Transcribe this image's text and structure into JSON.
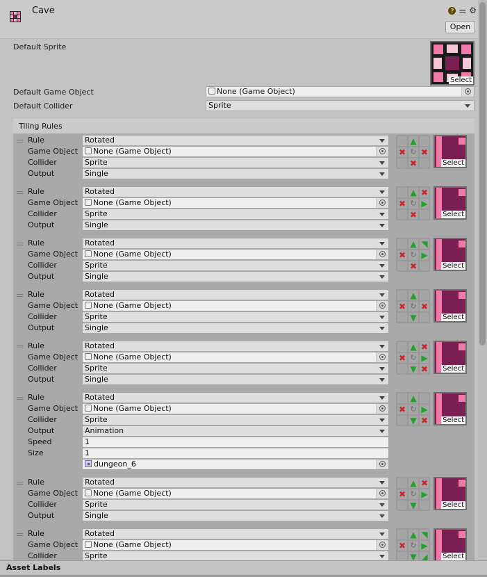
{
  "header": {
    "title": "Cave",
    "open_label": "Open",
    "icons": [
      "help-icon",
      "preset-icon",
      "gear-icon"
    ]
  },
  "defaults": {
    "sprite_label": "Default Sprite",
    "sprite_select": "Select",
    "game_object_label": "Default Game Object",
    "game_object_value": "None (Game Object)",
    "collider_label": "Default Collider",
    "collider_value": "Sprite"
  },
  "tiling_rules": {
    "title": "Tiling Rules",
    "field_labels": {
      "rule": "Rule",
      "game_object": "Game Object",
      "collider": "Collider",
      "output": "Output",
      "speed": "Speed",
      "size": "Size"
    },
    "select_label": "Select",
    "rules": [
      {
        "rule": "Rotated",
        "game_object": "None (Game Object)",
        "collider": "Sprite",
        "output": "Single",
        "grid": [
          "",
          "up",
          "",
          "x",
          "rotate",
          "x",
          "",
          "x",
          ""
        ]
      },
      {
        "rule": "Rotated",
        "game_object": "None (Game Object)",
        "collider": "Sprite",
        "output": "Single",
        "grid": [
          "",
          "up",
          "x",
          "x",
          "rotate",
          "right",
          "",
          "x",
          ""
        ]
      },
      {
        "rule": "Rotated",
        "game_object": "None (Game Object)",
        "collider": "Sprite",
        "output": "Single",
        "grid": [
          "",
          "up",
          "up-right",
          "x",
          "rotate",
          "right",
          "",
          "x",
          ""
        ]
      },
      {
        "rule": "Rotated",
        "game_object": "None (Game Object)",
        "collider": "Sprite",
        "output": "Single",
        "grid": [
          "",
          "up",
          "",
          "x",
          "rotate",
          "x",
          "",
          "down",
          ""
        ]
      },
      {
        "rule": "Rotated",
        "game_object": "None (Game Object)",
        "collider": "Sprite",
        "output": "Single",
        "grid": [
          "",
          "up",
          "x",
          "x",
          "rotate",
          "right",
          "",
          "down",
          "x"
        ]
      },
      {
        "rule": "Rotated",
        "game_object": "None (Game Object)",
        "collider": "Sprite",
        "output": "Animation",
        "speed": "1",
        "size": "1",
        "sprites": [
          "dungeon_6"
        ],
        "grid": [
          "",
          "up",
          "",
          "x",
          "rotate",
          "right",
          "",
          "down",
          "x"
        ]
      },
      {
        "rule": "Rotated",
        "game_object": "None (Game Object)",
        "collider": "Sprite",
        "output": "Single",
        "grid": [
          "",
          "up",
          "x",
          "x",
          "rotate",
          "right",
          "",
          "down",
          ""
        ]
      },
      {
        "rule": "Rotated",
        "game_object": "None (Game Object)",
        "collider": "Sprite",
        "output": "",
        "grid": [
          "",
          "up",
          "up-right",
          "x",
          "rotate",
          "right",
          "",
          "down",
          "down-right"
        ]
      }
    ]
  },
  "footer": {
    "asset_labels": "Asset Labels"
  },
  "colors": {
    "accent_green": "#1fa22a",
    "accent_red": "#c8282c",
    "sprite_maroon": "#7a1f52",
    "sprite_pink": "#f07aa8"
  }
}
